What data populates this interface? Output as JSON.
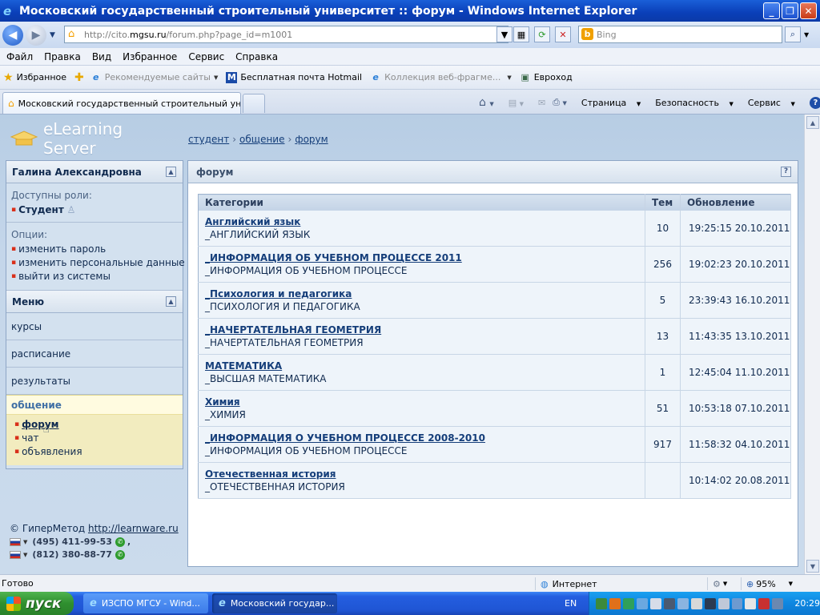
{
  "window": {
    "title": "Московский государственный строительный университет :: форум - Windows Internet Explorer"
  },
  "toolbar": {
    "address_prefix": "http://cito.",
    "address_domain": "mgsu.ru",
    "address_rest": "/forum.php?page_id=m1001",
    "search_placeholder": "Bing"
  },
  "menubar": [
    "Файл",
    "Правка",
    "Вид",
    "Избранное",
    "Сервис",
    "Справка"
  ],
  "favorites": {
    "label": "Избранное",
    "items": [
      "Рекомендуемые сайты",
      "Бесплатная почта Hotmail",
      "Коллекция веб-фрагме...",
      "Евроход"
    ]
  },
  "tabs": {
    "active": "Московский государственный строительный унив..."
  },
  "commandbar": {
    "page": "Страница",
    "security": "Безопасность",
    "service": "Сервис"
  },
  "site": {
    "logo": "eLearning Server",
    "breadcrumb": [
      "студент",
      "общение",
      "форум"
    ]
  },
  "sidebar": {
    "user_name": "Галина  Александровна",
    "roles_label": "Доступны роли:",
    "role": "Студент",
    "options_label": "Опции:",
    "options": [
      "изменить пароль",
      "изменить персональные данные",
      "выйти из системы"
    ],
    "menu_title": "Меню",
    "menu": [
      "курсы",
      "расписание",
      "результаты"
    ],
    "active_group": "общение",
    "active_items": [
      "форум",
      "чат",
      "объявления"
    ]
  },
  "footer": {
    "copyright": "© ГиперМетод",
    "link": "http://learnware.ru",
    "phone1": "(495) 411-99-53",
    "phone2": "(812) 380-88-77",
    "comma": ","
  },
  "main": {
    "title": "форум",
    "columns": [
      "Категории",
      "Тем",
      "Обновление"
    ],
    "rows": [
      {
        "title": "Английский язык",
        "desc": "_АНГЛИЙСКИЙ ЯЗЫК",
        "count": "10",
        "updated": "19:25:15 20.10.2011"
      },
      {
        "title": "_ИНФОРМАЦИЯ ОБ УЧЕБНОМ ПРОЦЕССЕ 2011",
        "desc": "_ИНФОРМАЦИЯ ОБ УЧЕБНОМ ПРОЦЕССЕ",
        "count": "256",
        "updated": "19:02:23 20.10.2011"
      },
      {
        "title": "_Психология и педагогика",
        "desc": "_ПСИХОЛОГИЯ И ПЕДАГОГИКА",
        "count": "5",
        "updated": "23:39:43 16.10.2011"
      },
      {
        "title": "_НАЧЕРТАТЕЛЬНАЯ ГЕОМЕТРИЯ",
        "desc": "_НАЧЕРТАТЕЛЬНАЯ ГЕОМЕТРИЯ",
        "count": "13",
        "updated": "11:43:35 13.10.2011"
      },
      {
        "title": "МАТЕМАТИКА",
        "desc": "_ВЫСШАЯ МАТЕМАТИКА",
        "count": "1",
        "updated": "12:45:04 11.10.2011"
      },
      {
        "title": "Химия",
        "desc": "_ХИМИЯ",
        "count": "51",
        "updated": "10:53:18 07.10.2011"
      },
      {
        "title": "_ИНФОРМАЦИЯ О УЧЕБНОМ ПРОЦЕССЕ 2008-2010",
        "desc": "_ИНФОРМАЦИЯ ОБ УЧЕБНОМ ПРОЦЕССЕ",
        "count": "917",
        "updated": "11:58:32 04.10.2011"
      },
      {
        "title": "Отечественная история",
        "desc": "_ОТЕЧЕСТВЕННАЯ ИСТОРИЯ",
        "count": "",
        "updated": "10:14:02 20.08.2011"
      }
    ]
  },
  "statusbar": {
    "text": "Готово",
    "zone": "Интернет",
    "zoom": "95%"
  },
  "taskbar": {
    "start": "пуск",
    "tasks": [
      "ИЗСПО МГСУ - Wind...",
      "Московский государ..."
    ],
    "lang": "EN",
    "clock": "20:29"
  }
}
